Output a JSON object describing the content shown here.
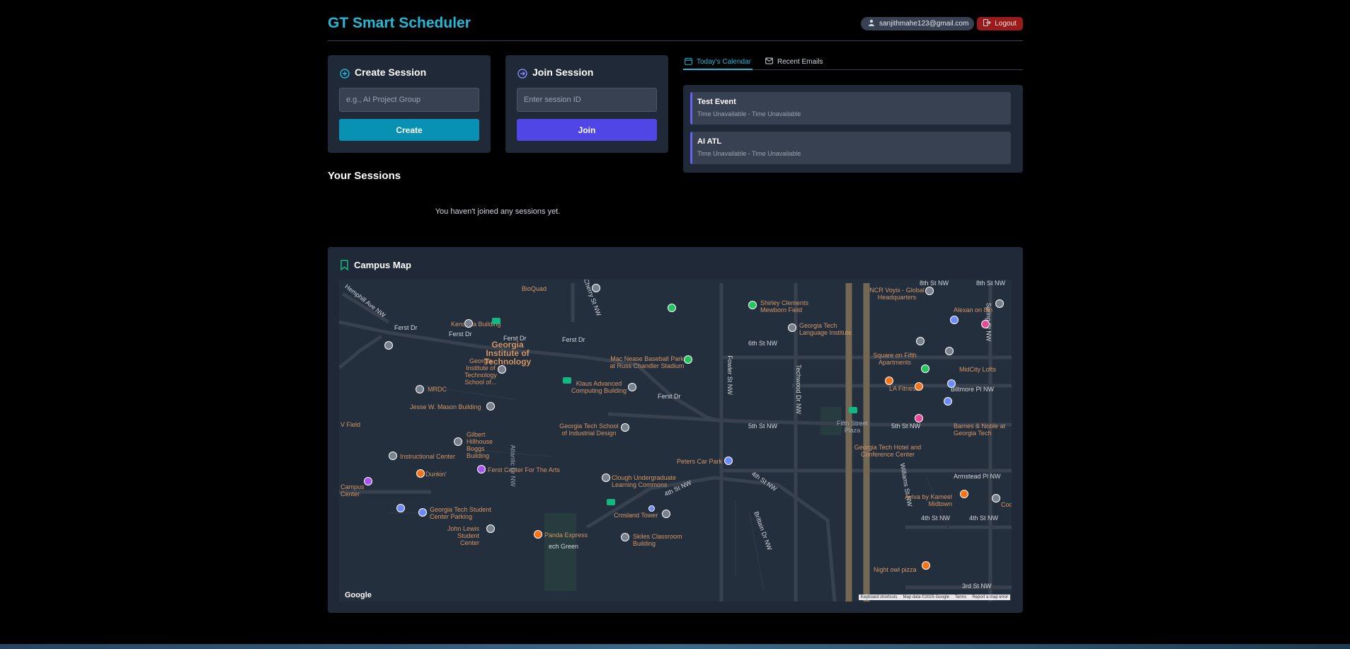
{
  "header": {
    "title": "GT Smart Scheduler",
    "user_email": "sanjithmahe123@gmail.com",
    "logout_label": "Logout"
  },
  "create_session": {
    "title": "Create Session",
    "placeholder": "e.g., AI Project Group",
    "button_label": "Create"
  },
  "join_session": {
    "title": "Join Session",
    "placeholder": "Enter session ID",
    "button_label": "Join"
  },
  "tabs": [
    {
      "label": "Today's Calendar",
      "active": true
    },
    {
      "label": "Recent Emails",
      "active": false
    }
  ],
  "calendar_events": [
    {
      "title": "Test Event",
      "time": "Time Unavailable - Time Unavailable"
    },
    {
      "title": "AI ATL",
      "time": "Time Unavailable - Time Unavailable"
    }
  ],
  "sessions": {
    "title": "Your Sessions",
    "empty_message": "You haven't joined any sessions yet."
  },
  "map": {
    "title": "Campus Map",
    "google_label": "Google",
    "attribution": [
      "Keyboard shortcuts",
      "Map data ©2025 Google",
      "Terms",
      "Report a map error"
    ],
    "labels": {
      "georgia_tech": "Georgia Institute of Technology",
      "bioquad": "BioQuad",
      "kendeda": "Kendeda Building",
      "ferst_dr_1": "Ferst Dr",
      "ferst_dr_2": "Ferst Dr",
      "ferst_dr_3": "Ferst Dr",
      "ferst_dr_4": "Ferst Dr",
      "ferst_dr_5": "Ferst Dr",
      "gt_school": "Georgia Institute of Technology School of...",
      "mrdc": "MRDC",
      "mason": "Jesse W. Mason Building",
      "gilbert": "Gilbert Hillhouse Boggs Building",
      "instructional": "Instructional Center",
      "dunkin": "Dunkin'",
      "ferst_center": "Ferst Center For The Arts",
      "student_parking": "Georgia Tech Student Center Parking",
      "john_lewis": "John Lewis Student Center",
      "panda": "Panda Express",
      "skiles": "Skiles Classroom Building",
      "crosland": "Crosland Tower",
      "clough": "Clough Undergraduate Learning Commons",
      "tech_green": "ech Green",
      "industrial_design": "Georgia Tech School of Industrial Design",
      "klaus": "Klaus Advanced Computing Building",
      "baseball": "Mac Nease Baseball Park at Russ Chandler Stadium",
      "shirley": "Shirley Clements Mewborn Field",
      "language": "Georgia Tech Language Institute",
      "peters": "Peters Car Park",
      "sixth_st": "6th St NW",
      "fifth_st": "5th St NW",
      "fifth_st_2": "5th St NW",
      "fourth_st": "4th St NW",
      "fourth_st_2": "4th St NW",
      "fourth_st_3": "4th St NW",
      "fourth_st_4": "4th St NW",
      "eighth_st": "8th St NW",
      "eighth_st_2": "8th St NW",
      "third_st": "3rd St NW",
      "fowler": "Fowler St NW",
      "techwood": "Techwood Dr NW",
      "spring": "Spring St NW",
      "williams": "Williams St NW",
      "ncr": "NCR Voyix - Global Headquarters",
      "alexan": "Alexan on 8th",
      "square": "Square on Fifth Apartments",
      "midcity": "MidCity Lofts",
      "la_fitness": "LA Fitness",
      "biltmore": "Biltmore Pl NW",
      "barnes": "Barnes & Noble at Georgia Tech",
      "fifth_plaza": "Fifth Street Plaza",
      "hotel": "Georgia Tech Hotel and Conference Center",
      "armstead": "Armstead Pl NW",
      "aviva": "Aviva by Kameel Midtown",
      "night_owl": "Night owl pizza",
      "hemphill": "Hemphill Ave NW",
      "campus_center": "Campus Center",
      "v_field": "V Field",
      "cherry": "Cherry St NW",
      "atlantic": "Atlantic Dr NW",
      "brittain": "Brittain Dr NW",
      "cod": "Cod"
    }
  },
  "colors": {
    "accent": "#22b8d8",
    "join": "#4f46e5",
    "create": "#0891b2",
    "logout": "#991b1b"
  }
}
